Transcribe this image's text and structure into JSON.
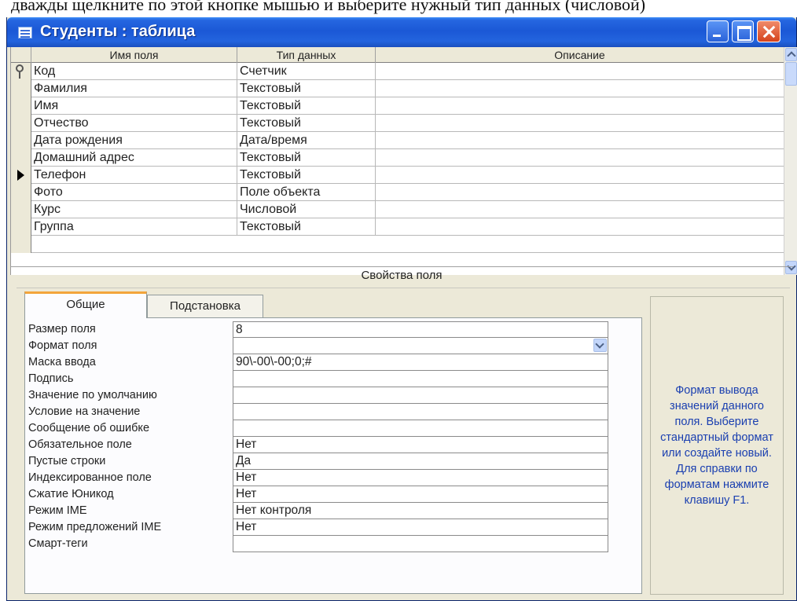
{
  "caption": "дважды щелкните по этой кнопке мышью и выберите нужный тип данных (числовой)",
  "window": {
    "title": "Студенты : таблица"
  },
  "grid": {
    "headers": {
      "name": "Имя поля",
      "type": "Тип данных",
      "description": "Описание"
    },
    "rows": [
      {
        "name": "Код",
        "type": "Счетчик",
        "description": "",
        "marker": "key"
      },
      {
        "name": "Фамилия",
        "type": "Текстовый",
        "description": "",
        "marker": ""
      },
      {
        "name": "Имя",
        "type": "Текстовый",
        "description": "",
        "marker": ""
      },
      {
        "name": "Отчество",
        "type": "Текстовый",
        "description": "",
        "marker": ""
      },
      {
        "name": "Дата рождения",
        "type": "Дата/время",
        "description": "",
        "marker": ""
      },
      {
        "name": "Домашний адрес",
        "type": "Текстовый",
        "description": "",
        "marker": ""
      },
      {
        "name": "Телефон",
        "type": "Текстовый",
        "description": "",
        "marker": "current"
      },
      {
        "name": "Фото",
        "type": "Поле объекта",
        "description": "",
        "marker": ""
      },
      {
        "name": "Курс",
        "type": "Числовой",
        "description": "",
        "marker": ""
      },
      {
        "name": "Группа",
        "type": "Текстовый",
        "description": "",
        "marker": ""
      }
    ]
  },
  "field_properties": {
    "section_title": "Свойства поля",
    "tabs": {
      "general": "Общие",
      "lookup": "Подстановка"
    },
    "properties": [
      {
        "label": "Размер поля",
        "value": "8"
      },
      {
        "label": "Формат поля",
        "value": "",
        "dropdown": true
      },
      {
        "label": "Маска ввода",
        "value": "90\\-00\\-00;0;#"
      },
      {
        "label": "Подпись",
        "value": ""
      },
      {
        "label": "Значение по умолчанию",
        "value": ""
      },
      {
        "label": "Условие на значение",
        "value": ""
      },
      {
        "label": "Сообщение об ошибке",
        "value": ""
      },
      {
        "label": "Обязательное поле",
        "value": "Нет"
      },
      {
        "label": "Пустые строки",
        "value": "Да"
      },
      {
        "label": "Индексированное поле",
        "value": "Нет"
      },
      {
        "label": "Сжатие Юникод",
        "value": "Нет"
      },
      {
        "label": "Режим IME",
        "value": "Нет контроля"
      },
      {
        "label": "Режим предложений IME",
        "value": "Нет"
      },
      {
        "label": "Смарт-теги",
        "value": ""
      }
    ],
    "help_text": "Формат вывода значений данного поля. Выберите стандартный формат или создайте новый. Для справки по форматам нажмите клавишу F1."
  }
}
